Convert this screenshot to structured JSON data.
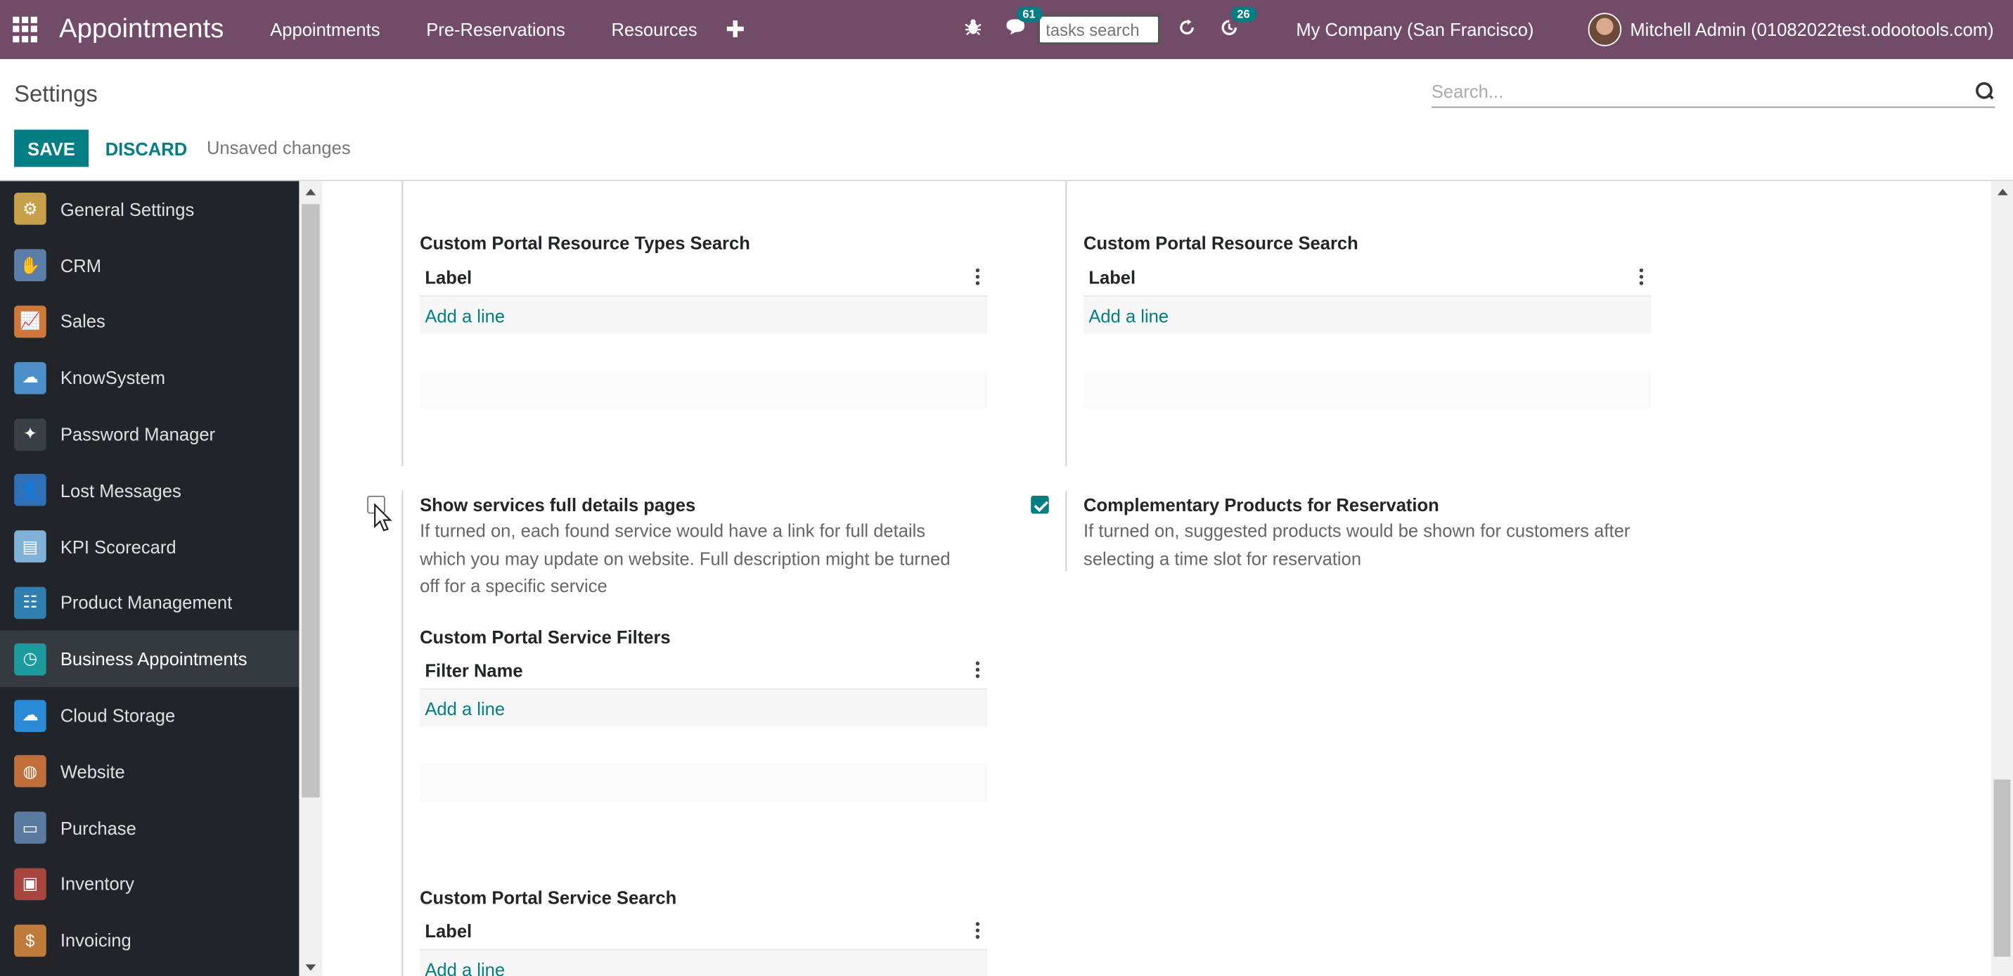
{
  "navbar": {
    "brand": "Appointments",
    "menu": [
      "Appointments",
      "Pre-Reservations",
      "Resources"
    ],
    "chat_count": "61",
    "activity_count": "26",
    "tasks_search_placeholder": "tasks search",
    "company": "My Company (San Francisco)",
    "user": "Mitchell Admin (01082022test.odootools.com)"
  },
  "control_panel": {
    "title": "Settings",
    "search_placeholder": "Search...",
    "save_label": "SAVE",
    "discard_label": "DISCARD",
    "status": "Unsaved changes"
  },
  "sidebar": {
    "items": [
      {
        "label": "General Settings",
        "color": "#c9a04a"
      },
      {
        "label": "CRM",
        "color": "#5a7ea8"
      },
      {
        "label": "Sales",
        "color": "#d0783a"
      },
      {
        "label": "KnowSystem",
        "color": "#4a8fc9"
      },
      {
        "label": "Password Manager",
        "color": "#3b3f46"
      },
      {
        "label": "Lost Messages",
        "color": "#2e6fb5"
      },
      {
        "label": "KPI Scorecard",
        "color": "#7fb2d6"
      },
      {
        "label": "Product Management",
        "color": "#2f7fb0"
      },
      {
        "label": "Business Appointments",
        "color": "#1b9aa0"
      },
      {
        "label": "Cloud Storage",
        "color": "#2a8ad6"
      },
      {
        "label": "Website",
        "color": "#c06f3a"
      },
      {
        "label": "Purchase",
        "color": "#5b7aa0"
      },
      {
        "label": "Inventory",
        "color": "#a8453f"
      },
      {
        "label": "Invoicing",
        "color": "#c07a3a"
      }
    ],
    "active_index": 8
  },
  "content": {
    "resource_types_search": {
      "title": "Custom Portal Resource Types Search",
      "column": "Label",
      "add": "Add a line"
    },
    "resource_search": {
      "title": "Custom Portal Resource Search",
      "column": "Label",
      "add": "Add a line"
    },
    "show_services": {
      "title": "Show services full details pages",
      "desc_lines": [
        "If turned on, each found service would have a link for full details",
        "which you may update on website. Full description might be turned",
        "off for a specific service"
      ],
      "checked": false
    },
    "complementary": {
      "title": "Complementary Products for Reservation",
      "desc_lines": [
        "If turned on, suggested products would be shown for customers after",
        "selecting a time slot for reservation"
      ],
      "checked": true
    },
    "service_filters": {
      "title": "Custom Portal Service Filters",
      "column": "Filter Name",
      "add": "Add a line"
    },
    "service_search": {
      "title": "Custom Portal Service Search",
      "column": "Label",
      "add": "Add a line"
    }
  }
}
